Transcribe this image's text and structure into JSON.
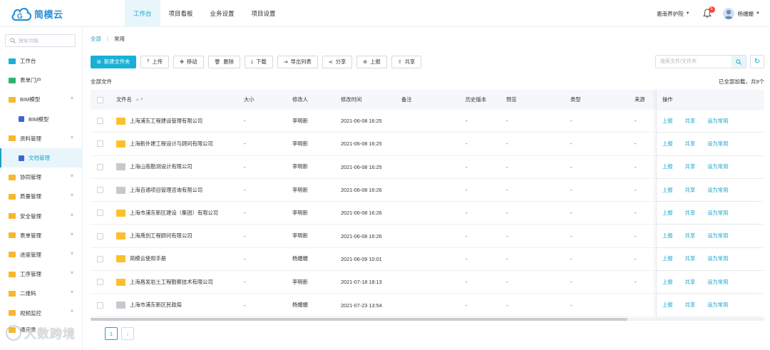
{
  "app": {
    "name": "简模云"
  },
  "nav": [
    {
      "label": "工作台",
      "active": true
    },
    {
      "label": "项目看板",
      "active": false
    },
    {
      "label": "业务设置",
      "active": false
    },
    {
      "label": "项目设置",
      "active": false
    }
  ],
  "header": {
    "org": "惠南养护院",
    "notifications": "5",
    "user": "杨姗姗"
  },
  "sidebar": {
    "search_placeholder": "搜索功能",
    "items": [
      {
        "label": "工作台",
        "icon": "dashboard-icon"
      },
      {
        "label": "表单门户",
        "icon": "form-portal-icon"
      },
      {
        "label": "BIM模型",
        "icon": "folder-icon",
        "arrow": "˄"
      },
      {
        "label": "BIM模型",
        "icon": "model-icon",
        "sub": true
      },
      {
        "label": "资料管理",
        "icon": "folder-icon",
        "arrow": "˄"
      },
      {
        "label": "文档管理",
        "icon": "document-icon",
        "sub": true,
        "active": true
      },
      {
        "label": "协同管理",
        "icon": "folder-icon",
        "arrow": "˅"
      },
      {
        "label": "质量管理",
        "icon": "folder-icon",
        "arrow": "˅"
      },
      {
        "label": "安全管理",
        "icon": "folder-icon",
        "arrow": "˅"
      },
      {
        "label": "表单管理",
        "icon": "folder-icon",
        "arrow": "˅"
      },
      {
        "label": "进度管理",
        "icon": "folder-icon",
        "arrow": "˅"
      },
      {
        "label": "工序管理",
        "icon": "folder-icon",
        "arrow": "˅"
      },
      {
        "label": "二维码",
        "icon": "folder-icon",
        "arrow": "˅"
      },
      {
        "label": "视频监控",
        "icon": "folder-icon",
        "arrow": "˅"
      }
    ],
    "last_item": "通讯录"
  },
  "breadcrumb": {
    "root": "全部",
    "current": "常用"
  },
  "toolbar": {
    "new_folder": "新建文件夹",
    "upload": "上传",
    "move": "移动",
    "delete": "删除",
    "download": "下载",
    "export": "导出列表",
    "share": "分享",
    "report": "上报",
    "cobuild": "共享"
  },
  "search": {
    "placeholder": "搜索文件/文件夹"
  },
  "section_title": "全部文件",
  "loaded_text": "已全部加载，共9个",
  "table": {
    "headers": {
      "name": "文件名",
      "size": "大小",
      "modifier": "修改人",
      "time": "修改时间",
      "note": "备注",
      "version": "历史版本",
      "preview": "预览",
      "type": "类型",
      "source": "来源",
      "ops": "操作"
    },
    "ops": {
      "report": "上报",
      "share": "共享",
      "fav": "设为常用"
    },
    "rows": [
      {
        "name": "上海浦东工程建设管理有限公司",
        "color": "yellow",
        "size": "-",
        "modifier": "李明新",
        "time": "2021-06-08 16:25",
        "version": "-",
        "preview": "-",
        "type": "-",
        "source": "-"
      },
      {
        "name": "上海新外建工程设计与顾问有限公司",
        "color": "yellow",
        "size": "-",
        "modifier": "李明新",
        "time": "2021-06-08 16:25",
        "version": "-",
        "preview": "-",
        "type": "-",
        "source": "-"
      },
      {
        "name": "上海山南勘测设计有限公司",
        "color": "gray",
        "size": "-",
        "modifier": "李明新",
        "time": "2021-06-08 16:25",
        "version": "-",
        "preview": "-",
        "type": "-",
        "source": "-"
      },
      {
        "name": "上海百通项目管理咨询有限公司",
        "color": "gray",
        "size": "-",
        "modifier": "李明新",
        "time": "2021-06-08 16:26",
        "version": "-",
        "preview": "-",
        "type": "-",
        "source": "-"
      },
      {
        "name": "上海市浦东新区建设（集团）有限公司",
        "color": "yellow",
        "size": "-",
        "modifier": "李明新",
        "time": "2021-06-08 16:26",
        "version": "-",
        "preview": "-",
        "type": "-",
        "source": "-"
      },
      {
        "name": "上海禹创工程顾问有限公司",
        "color": "yellow",
        "size": "-",
        "modifier": "李明新",
        "time": "2021-06-08 16:26",
        "version": "-",
        "preview": "-",
        "type": "-",
        "source": "-"
      },
      {
        "name": "简模云使用手册",
        "color": "yellow",
        "size": "-",
        "modifier": "杨姗姗",
        "time": "2021-06-09 10:01",
        "version": "-",
        "preview": "-",
        "type": "-",
        "source": "-"
      },
      {
        "name": "上海昌发岩土工程勘察技术有限公司",
        "color": "yellow",
        "size": "-",
        "modifier": "李明新",
        "time": "2021-07-18 18:13",
        "version": "-",
        "preview": "-",
        "type": "-",
        "source": "-"
      },
      {
        "name": "上海市浦东新区民政局",
        "color": "gray",
        "size": "-",
        "modifier": "杨姗姗",
        "time": "2021-07-23 13:54",
        "version": "-",
        "preview": "-",
        "type": "-",
        "source": ""
      }
    ]
  },
  "pager": {
    "current": "1",
    "next": "›"
  },
  "watermark": {
    "text": "大数跨境"
  },
  "colors": {
    "accent": "#1aa3c8",
    "primary_button": "#19b0d6",
    "folder_yellow": "#fbc02d",
    "folder_gray": "#c7c9cc"
  }
}
